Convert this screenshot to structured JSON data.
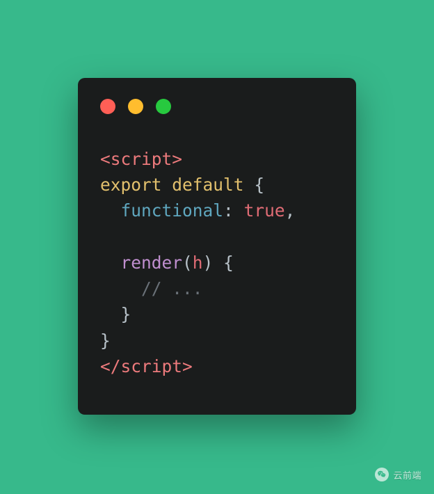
{
  "window": {
    "traffic_lights": {
      "red": "#ff5f56",
      "yellow": "#ffbd2e",
      "green": "#27c93f"
    }
  },
  "code": {
    "open_tag_open": "<",
    "open_tag_name": "script",
    "open_tag_close": ">",
    "kw_export": "export",
    "kw_default": "default",
    "brace_open": "{",
    "prop_functional": "functional",
    "colon1": ":",
    "bool_true": "true",
    "comma1": ",",
    "fn_render": "render",
    "paren_open": "(",
    "param_h": "h",
    "paren_close": ")",
    "brace_open2": "{",
    "comment": "// ...",
    "brace_close2": "}",
    "brace_close": "}",
    "close_tag_open": "</",
    "close_tag_name": "script",
    "close_tag_close": ">"
  },
  "watermark": {
    "label": "云前端"
  }
}
